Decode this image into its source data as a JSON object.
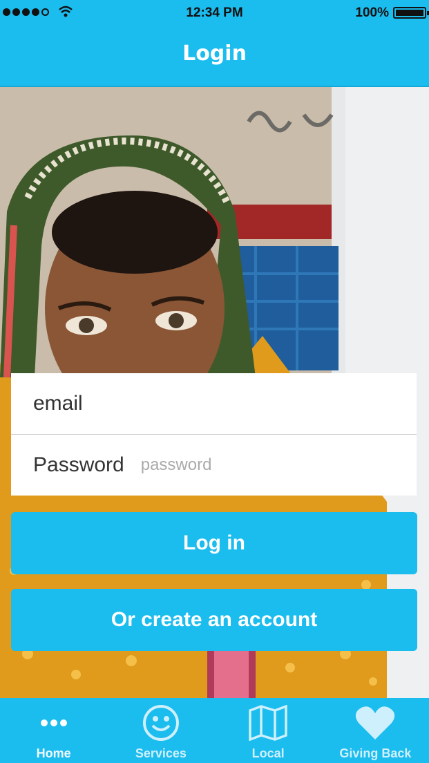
{
  "status_bar": {
    "time": "12:34 PM",
    "battery": "100%"
  },
  "nav": {
    "title": "Login"
  },
  "form": {
    "email_label": "email",
    "password_label": "Password",
    "password_placeholder": "password"
  },
  "buttons": {
    "login": "Log in",
    "create_account": "Or create an account"
  },
  "tabs": [
    {
      "label": "Home",
      "icon": "more-dots-icon",
      "active": true
    },
    {
      "label": "Services",
      "icon": "smiley-icon",
      "active": false
    },
    {
      "label": "Local",
      "icon": "map-icon",
      "active": false
    },
    {
      "label": "Giving Back",
      "icon": "heart-icon",
      "active": false
    }
  ],
  "colors": {
    "accent": "#1bbcee",
    "text_white": "#ffffff"
  }
}
